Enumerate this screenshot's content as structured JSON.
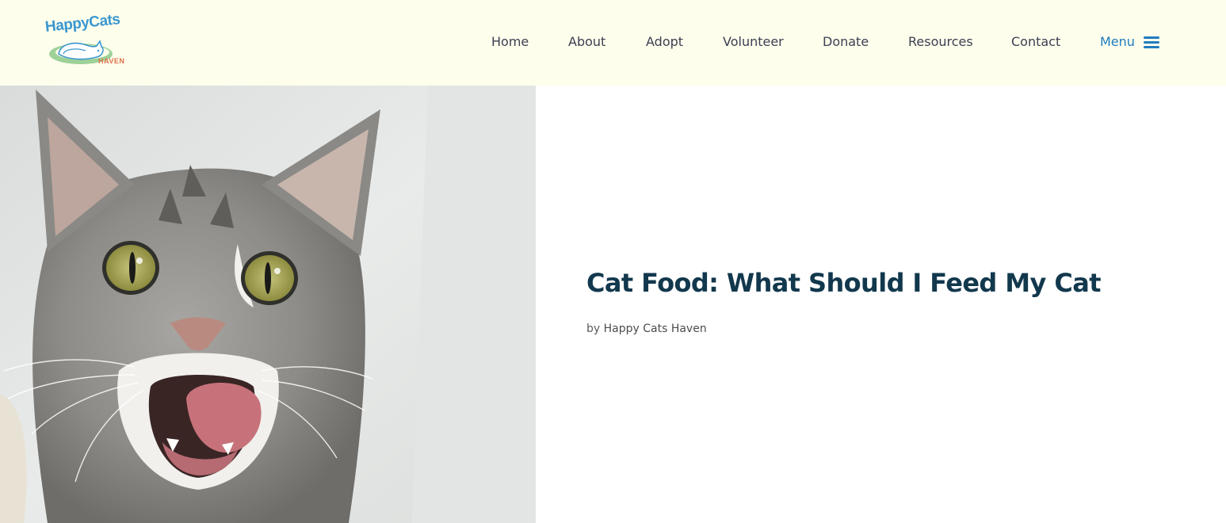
{
  "brand": {
    "logo_title": "HappyCats",
    "logo_subtitle": "HAVEN",
    "logo_alt": "Happy Cats Haven logo",
    "colors": {
      "header_bg": "#fefeec",
      "logo_blue": "#3a97d0",
      "logo_orange": "#e0704a",
      "logo_green": "#8cc98a",
      "nav_text": "#3b3f52",
      "menu_accent": "#1f7cc0",
      "title_text": "#12384d"
    }
  },
  "nav": {
    "items": [
      {
        "label": "Home"
      },
      {
        "label": "About"
      },
      {
        "label": "Adopt"
      },
      {
        "label": "Volunteer"
      },
      {
        "label": "Donate"
      },
      {
        "label": "Resources"
      },
      {
        "label": "Contact"
      }
    ],
    "menu_label": "Menu",
    "menu_icon": "hamburger-icon"
  },
  "hero": {
    "image_alt": "Gray tabby kitten licking its lips",
    "title": "Cat Food: What Should I Feed My Cat",
    "byline_prefix": "by",
    "author": "Happy Cats Haven"
  }
}
